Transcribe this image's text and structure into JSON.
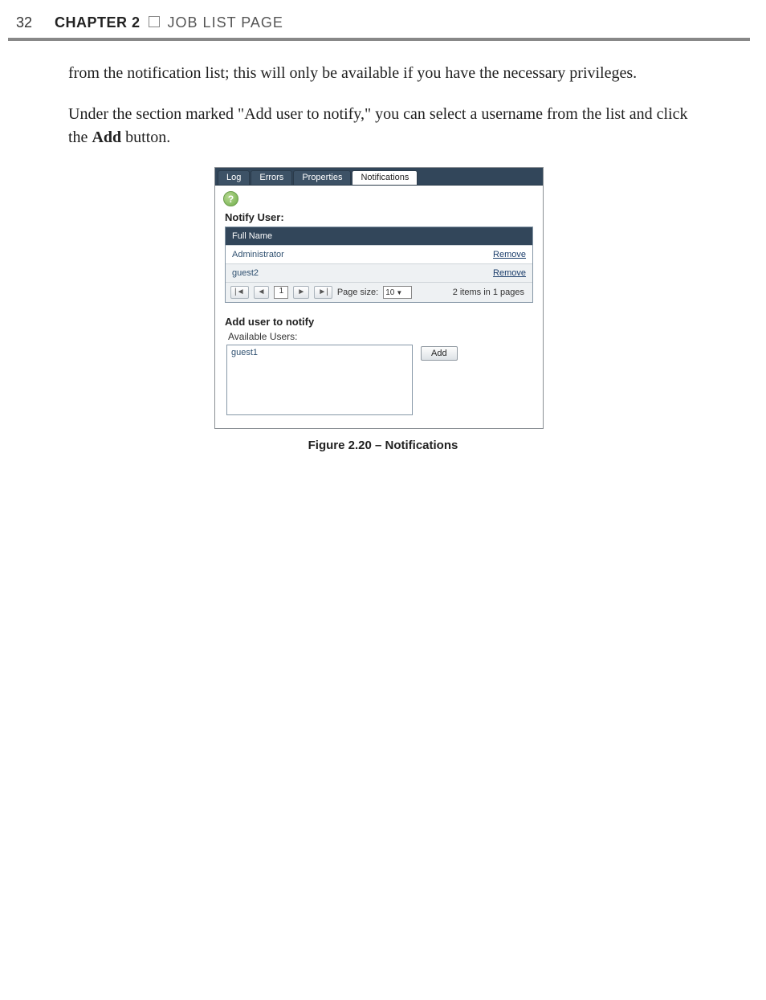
{
  "header": {
    "page_number": "32",
    "chapter_label": "CHAPTER 2",
    "chapter_title": "JOB LIST PAGE"
  },
  "body": {
    "p1": "from the notification list; this will only be available if you have the necessary privileges.",
    "p2_a": "Under the section marked \"Add user to notify,\" you can select a username from the list and click the ",
    "p2_bold": "Add",
    "p2_b": " button."
  },
  "screenshot": {
    "tabs": [
      "Log",
      "Errors",
      "Properties",
      "Notifications"
    ],
    "active_tab_index": 3,
    "help_glyph": "?",
    "notify_user_label": "Notify User:",
    "grid": {
      "header": "Full Name",
      "rows": [
        {
          "name": "Administrator",
          "action": "Remove"
        },
        {
          "name": "guest2",
          "action": "Remove"
        }
      ],
      "pager": {
        "first": "|◄",
        "prev": "◄",
        "page": "1",
        "next": "►",
        "last": "►|",
        "size_label": "Page size:",
        "size_value": "10",
        "summary": "2 items in 1 pages"
      }
    },
    "add_section_label": "Add user to notify",
    "available_users_label": "Available Users:",
    "available_users": [
      "guest1"
    ],
    "add_button": "Add"
  },
  "caption": "Figure 2.20 – Notifications"
}
